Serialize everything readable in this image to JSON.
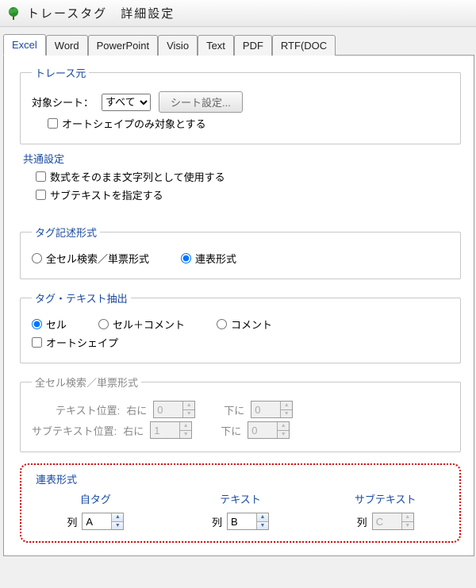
{
  "window": {
    "title": "トレースタグ　詳細設定"
  },
  "tabs": {
    "t0": "Excel",
    "t1": "Word",
    "t2": "PowerPoint",
    "t3": "Visio",
    "t4": "Text",
    "t5": "PDF",
    "t6": "RTF(DOC"
  },
  "traceSource": {
    "legend": "トレース元",
    "targetSheetLabel": "対象シート：",
    "targetSheetValue": "すべて",
    "sheetSettingsBtn": "シート設定...",
    "autoshapeOnly": "オートシェイプのみ対象とする"
  },
  "common": {
    "legend": "共通設定",
    "formulaAsString": "数式をそのまま文字列として使用する",
    "specifySubtext": "サブテキストを指定する"
  },
  "tagFormat": {
    "legend": "タグ記述形式",
    "allCell": "全セル検索／単票形式",
    "linked": "連表形式"
  },
  "tagExtract": {
    "legend": "タグ・テキスト抽出",
    "cell": "セル",
    "cellComment": "セル＋コメント",
    "comment": "コメント",
    "autoshape": "オートシェイプ"
  },
  "allCellFormat": {
    "legend": "全セル検索／単票形式",
    "textPosLabel": "テキスト位置:",
    "rightLabel": "右に",
    "downLabel": "下に",
    "subtextPosLabel": "サブテキスト位置:",
    "textRight": "0",
    "textDown": "0",
    "subRight": "1",
    "subDown": "0"
  },
  "linked": {
    "legend": "連表形式",
    "selfTag": "自タグ",
    "text": "テキスト",
    "subtext": "サブテキスト",
    "colLabel": "列",
    "colA": "A",
    "colB": "B",
    "colC": "C"
  }
}
